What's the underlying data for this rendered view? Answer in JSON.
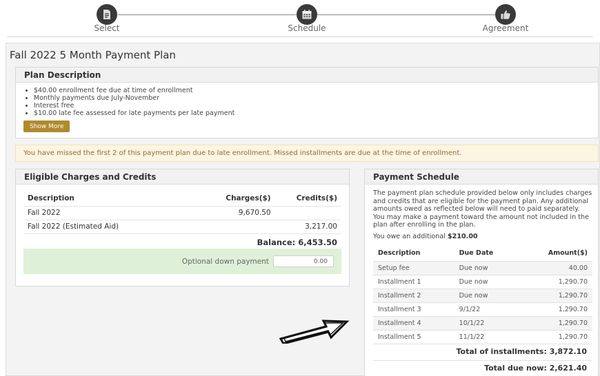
{
  "stepper": {
    "steps": [
      {
        "label": "Select",
        "icon": "document-icon"
      },
      {
        "label": "Schedule",
        "icon": "calendar-icon"
      },
      {
        "label": "Agreement",
        "icon": "thumbs-up-icon"
      }
    ]
  },
  "page": {
    "title": "Fall 2022 5 Month Payment Plan"
  },
  "plan_description": {
    "header": "Plan Description",
    "items": [
      "$40.00 enrollment fee due at time of enrollment",
      "Monthly payments due July-November",
      "Interest free",
      "$10.00 late fee assessed for late payments per late payment"
    ],
    "show_more_label": "Show More"
  },
  "alert": {
    "text": "You have missed the first 2 of this payment plan due to late enrollment. Missed installments are due at the time of enrollment."
  },
  "eligible": {
    "header": "Eligible Charges and Credits",
    "columns": [
      "Description",
      "Charges($)",
      "Credits($)"
    ],
    "rows": [
      {
        "description": "Fall 2022",
        "charges": "9,670.50",
        "credits": ""
      },
      {
        "description": "Fall 2022 (Estimated Aid)",
        "charges": "",
        "credits": "3,217.00"
      }
    ],
    "balance": "Balance: 6,453.50",
    "optional_label": "Optional down payment",
    "optional_value": "0.00"
  },
  "schedule": {
    "header": "Payment Schedule",
    "text": "The payment plan schedule provided below only includes charges and credits that are eligible for the payment plan. Any additional amounts owed as reflected below will need to paid separately. You may make a payment toward the amount not included in the plan after enrolling in the plan.",
    "owe_prefix": "You owe an additional ",
    "owe_amount": "$210.00",
    "columns": [
      "Description",
      "Due Date",
      "Amount($)"
    ],
    "rows": [
      {
        "description": "Setup fee",
        "due": "Due now",
        "amount": "40.00"
      },
      {
        "description": "Installment 1",
        "due": "Due now",
        "amount": "1,290.70"
      },
      {
        "description": "Installment 2",
        "due": "Due now",
        "amount": "1,290.70"
      },
      {
        "description": "Installment 3",
        "due": "9/1/22",
        "amount": "1,290.70"
      },
      {
        "description": "Installment 4",
        "due": "10/1/22",
        "amount": "1,290.70"
      },
      {
        "description": "Installment 5",
        "due": "11/1/22",
        "amount": "1,290.70"
      }
    ],
    "total_installments": "Total of installments: 3,872.10",
    "total_due_now": "Total due now: 2,621.40"
  }
}
